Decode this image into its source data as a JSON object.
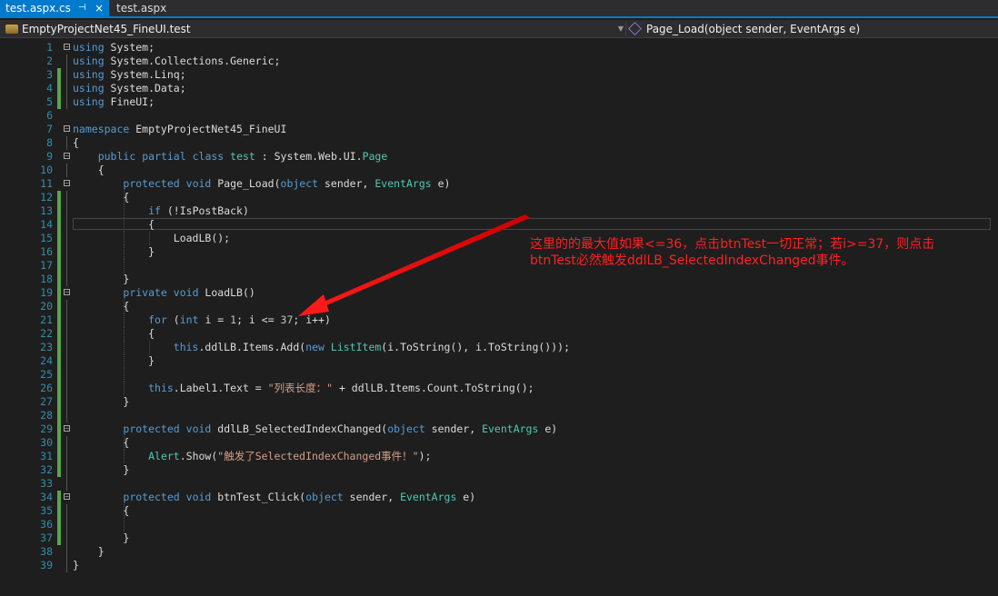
{
  "tabs": [
    {
      "label": "test.aspx.cs",
      "pin": "⊣",
      "close": "×"
    },
    {
      "label": "test.aspx"
    }
  ],
  "nav": {
    "project": "EmptyProjectNet45_FineUI.test",
    "member": "Page_Load(object sender, EventArgs e)"
  },
  "annotation": {
    "line1": "这里的的最大值如果<=36，点击btnTest一切正常；若i>=37，则点击",
    "line2": "btnTest必然触发ddlLB_SelectedIndexChanged事件。"
  },
  "lines": [
    {
      "n": "1",
      "html": "<span class='kw'>using</span> System;"
    },
    {
      "n": "2",
      "html": "<span class='kw'>using</span> System.Collections.Generic;"
    },
    {
      "n": "3",
      "html": "<span class='kw'>using</span> System.Linq;"
    },
    {
      "n": "4",
      "html": "<span class='kw'>using</span> System.Data;"
    },
    {
      "n": "5",
      "html": "<span class='kw'>using</span> FineUI;"
    },
    {
      "n": "6",
      "html": ""
    },
    {
      "n": "7",
      "html": "<span class='kw'>namespace</span> EmptyProjectNet45_FineUI"
    },
    {
      "n": "8",
      "html": "{"
    },
    {
      "n": "9",
      "html": "    <span class='kw'>public</span> <span class='kw'>partial</span> <span class='kw'>class</span> <span class='ty'>test</span> : System.Web.UI.<span class='ty'>Page</span>"
    },
    {
      "n": "10",
      "html": "    {"
    },
    {
      "n": "11",
      "html": "        <span class='kw'>protected</span> <span class='kw'>void</span> Page_Load(<span class='kw'>object</span> sender, <span class='ty'>EventArgs</span> e)"
    },
    {
      "n": "12",
      "html": "        {"
    },
    {
      "n": "13",
      "html": "            <span class='kw'>if</span> (!IsPostBack)"
    },
    {
      "n": "14",
      "html": "            {"
    },
    {
      "n": "15",
      "html": "                LoadLB();"
    },
    {
      "n": "16",
      "html": "            }"
    },
    {
      "n": "17",
      "html": ""
    },
    {
      "n": "18",
      "html": "        }"
    },
    {
      "n": "19",
      "html": "        <span class='kw'>private</span> <span class='kw'>void</span> LoadLB()"
    },
    {
      "n": "20",
      "html": "        {"
    },
    {
      "n": "21",
      "html": "            <span class='kw'>for</span> (<span class='kw'>int</span> i = <span class='nm'>1</span>; i &lt;= <span class='nm'>37</span>; i++)"
    },
    {
      "n": "22",
      "html": "            {"
    },
    {
      "n": "23",
      "html": "                <span class='kw'>this</span>.ddlLB.Items.Add(<span class='kw'>new</span> <span class='ty'>ListItem</span>(i.ToString(), i.ToString()));"
    },
    {
      "n": "24",
      "html": "            }"
    },
    {
      "n": "25",
      "html": ""
    },
    {
      "n": "26",
      "html": "            <span class='kw'>this</span>.Label1.Text = <span class='st'>\"列表长度：\"</span> + ddlLB.Items.Count.ToString();"
    },
    {
      "n": "27",
      "html": "        }"
    },
    {
      "n": "28",
      "html": ""
    },
    {
      "n": "29",
      "html": "        <span class='kw'>protected</span> <span class='kw'>void</span> ddlLB_SelectedIndexChanged(<span class='kw'>object</span> sender, <span class='ty'>EventArgs</span> e)"
    },
    {
      "n": "30",
      "html": "        {"
    },
    {
      "n": "31",
      "html": "            <span class='ty'>Alert</span>.Show(<span class='st'>\"触发了SelectedIndexChanged事件！\"</span>);"
    },
    {
      "n": "32",
      "html": "        }"
    },
    {
      "n": "33",
      "html": ""
    },
    {
      "n": "34",
      "html": "        <span class='kw'>protected</span> <span class='kw'>void</span> btnTest_Click(<span class='kw'>object</span> sender, <span class='ty'>EventArgs</span> e)"
    },
    {
      "n": "35",
      "html": "        {"
    },
    {
      "n": "36",
      "html": ""
    },
    {
      "n": "37",
      "html": "        }"
    },
    {
      "n": "38",
      "html": "    }"
    },
    {
      "n": "39",
      "html": "}"
    }
  ]
}
